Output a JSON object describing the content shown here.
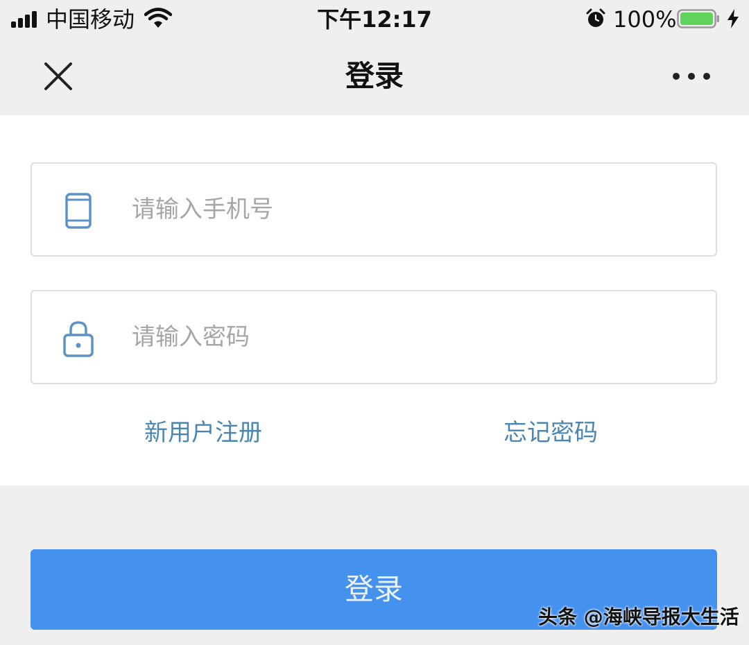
{
  "status_bar": {
    "carrier": "中国移动",
    "time": "下午12:17",
    "battery_percent": "100%",
    "icons": [
      "signal-icon",
      "wifi-icon",
      "alarm-icon",
      "battery-icon",
      "charging-icon"
    ]
  },
  "nav": {
    "title": "登录",
    "close_icon": "close-icon",
    "more_icon": "more-icon"
  },
  "form": {
    "phone": {
      "placeholder": "请输入手机号",
      "value": "",
      "icon": "phone-icon"
    },
    "password": {
      "placeholder": "请输入密码",
      "value": "",
      "icon": "lock-icon"
    },
    "register_label": "新用户注册",
    "forgot_label": "忘记密码"
  },
  "login_button": {
    "label": "登录"
  },
  "watermark": "头条 @海峡导报大生活",
  "colors": {
    "accent": "#4591ee",
    "link": "#4a86b0",
    "icon": "#5b93c7",
    "background": "#efefef",
    "card": "#ffffff"
  }
}
